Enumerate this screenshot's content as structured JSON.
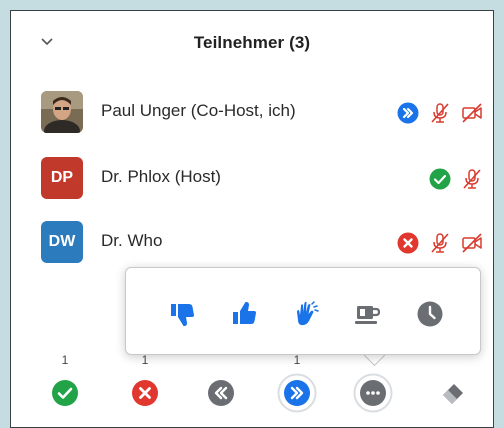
{
  "header": {
    "title": "Teilnehmer (3)"
  },
  "participants": [
    {
      "name": "Paul Unger (Co-Host, ich)",
      "initials": "",
      "avatar_color": "#6b5a45",
      "status": "faster",
      "mic": "muted",
      "video": "off"
    },
    {
      "name": "Dr. Phlox (Host)",
      "initials": "DP",
      "avatar_color": "#c0392b",
      "status": "yes",
      "mic": "muted",
      "video": ""
    },
    {
      "name": "Dr. Who",
      "initials": "DW",
      "avatar_color": "#2c7bbd",
      "status": "no",
      "mic": "muted",
      "video": "off"
    }
  ],
  "reactions_popup": {
    "items": [
      "thumbs-down-icon",
      "thumbs-up-icon",
      "clap-icon",
      "coffee-icon",
      "clock-icon"
    ]
  },
  "toolbar": {
    "counts": {
      "yes": "1",
      "no": "1",
      "faster": "1"
    },
    "buttons": [
      "yes-button",
      "no-button",
      "slower-button",
      "faster-button",
      "more-button",
      "clear-button"
    ]
  },
  "colors": {
    "blue": "#1a73e8",
    "green": "#22a348",
    "red": "#e0382e",
    "gray": "#6a6e73",
    "mute_red": "#d93a2f"
  }
}
